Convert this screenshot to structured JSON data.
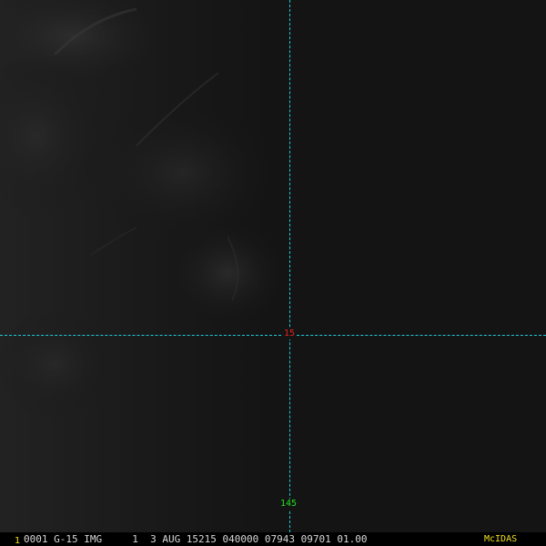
{
  "display": {
    "frame_number": "1",
    "image_header": "0001 G-15 IMG     1  3 AUG 15215 040000 07943 09701 01.00",
    "brand": "McIDAS"
  },
  "map_grid": {
    "latitude_label": "15",
    "longitude_label": "145"
  },
  "colors": {
    "grid_line": "#20c8d8",
    "latitude_label": "#e02020",
    "longitude_label": "#20e020",
    "frame_number": "#f0e020",
    "brand": "#f0e020",
    "header_text": "#d8d8d8",
    "background": "#141414"
  }
}
